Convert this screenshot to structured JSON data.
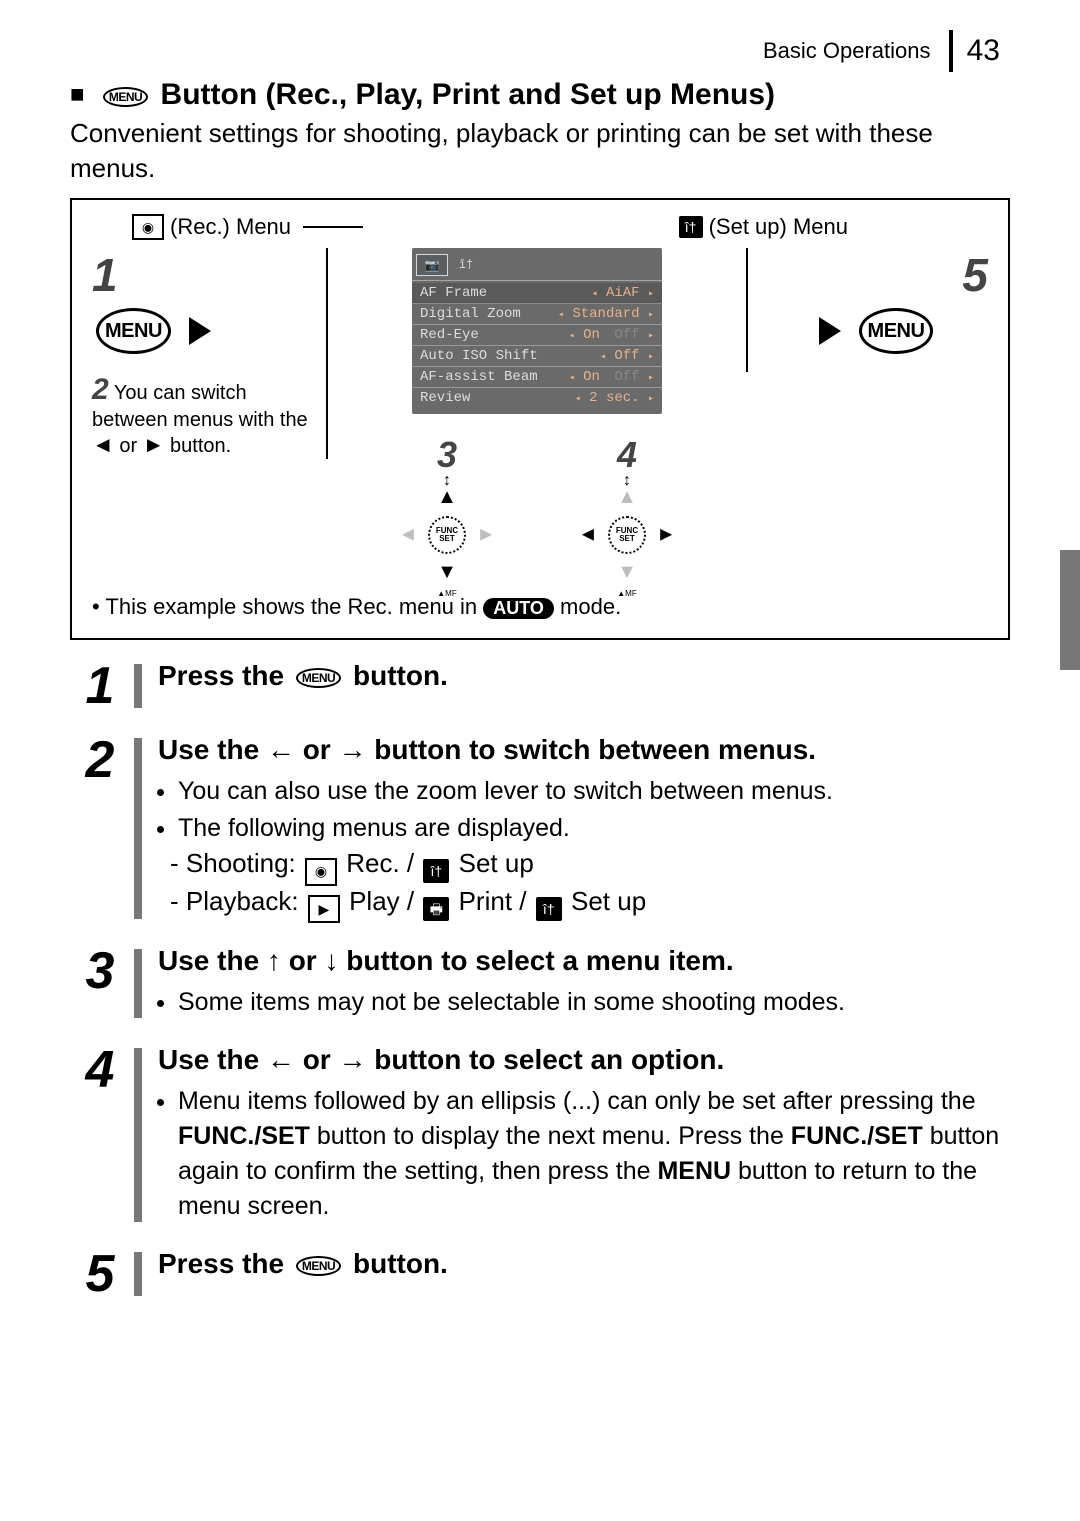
{
  "header": {
    "section": "Basic Operations",
    "page_number": "43"
  },
  "title": {
    "menu_label": "MENU",
    "text": "Button (Rec., Play, Print and Set up Menus)"
  },
  "intro": "Convenient settings for shooting, playback or printing can be set with these menus.",
  "diagram": {
    "rec_menu_label": "(Rec.) Menu",
    "setup_menu_label": "(Set up) Menu",
    "step1_num": "1",
    "step5_num": "5",
    "menu_button_label": "MENU",
    "step2_num": "2",
    "step2_text_a": "You can switch between menus with the ",
    "step2_text_b": " or ",
    "step2_text_c": " button.",
    "step3_num": "3",
    "step4_num": "4",
    "func_set_label": "FUNC\nSET",
    "lcd": {
      "rows": [
        {
          "label": "AF Frame",
          "value": "AiAF"
        },
        {
          "label": "Digital Zoom",
          "value": "Standard"
        },
        {
          "label": "Red-Eye",
          "value": "On",
          "alt": "Off"
        },
        {
          "label": "Auto ISO Shift",
          "value": "Off"
        },
        {
          "label": "AF-assist Beam",
          "value": "On",
          "alt": "Off"
        },
        {
          "label": "Review",
          "value": "2 sec."
        }
      ]
    },
    "footnote_a": "This example shows the Rec. menu in ",
    "footnote_auto": "AUTO",
    "footnote_b": " mode."
  },
  "steps": [
    {
      "num": "1",
      "head_a": "Press the ",
      "head_b": " button.",
      "menu_inline": "MENU"
    },
    {
      "num": "2",
      "head": "Use the ← or → button to switch between menus.",
      "bullets": [
        "You can also use the zoom lever to switch between menus.",
        "The following menus are displayed."
      ],
      "sub_shooting_label": "Shooting:",
      "sub_shooting_rec": "Rec. /",
      "sub_shooting_setup": "Set up",
      "sub_playback_label": "Playback:",
      "sub_playback_play": "Play /",
      "sub_playback_print": "Print /",
      "sub_playback_setup": "Set up"
    },
    {
      "num": "3",
      "head": "Use the ↑ or ↓ button to select a menu item.",
      "bullets": [
        "Some items may not be selectable in some shooting modes."
      ]
    },
    {
      "num": "4",
      "head": "Use the ← or → button to select an option.",
      "bullets": [
        "Menu items followed by an ellipsis (...) can only be set after pressing the FUNC./SET button to display the next menu. Press the FUNC./SET button again to confirm the setting, then press the MENU button to return to the menu screen."
      ]
    },
    {
      "num": "5",
      "head_a": "Press the ",
      "head_b": " button.",
      "menu_inline": "MENU"
    }
  ]
}
